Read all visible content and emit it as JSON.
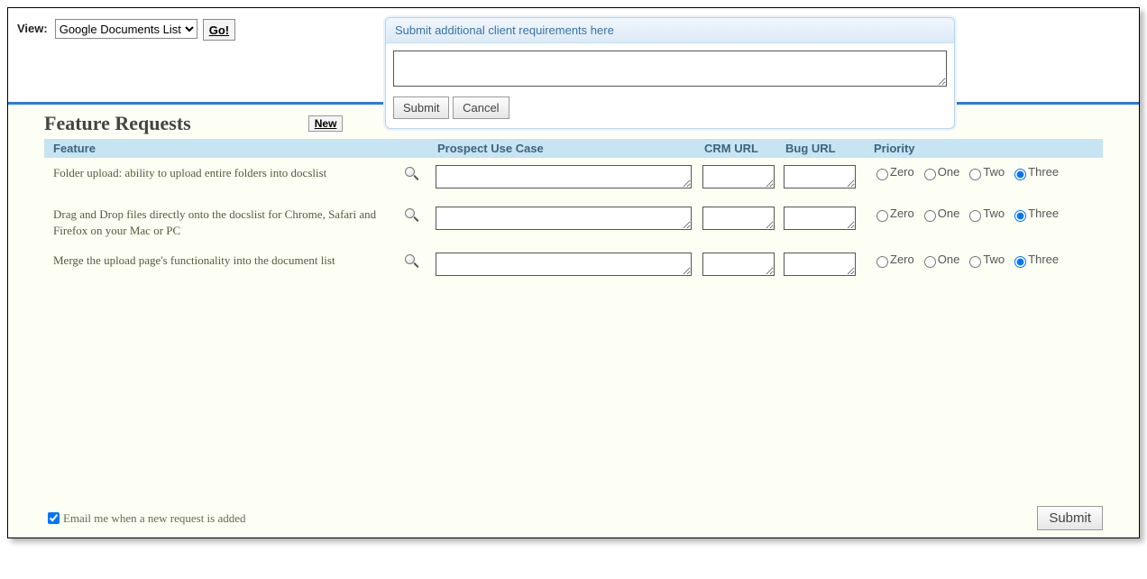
{
  "topbar": {
    "view_label": "View:",
    "select_value": "Google Documents List",
    "go_label": "Go!"
  },
  "req_panel": {
    "title": "Submit additional client requirements here",
    "textarea_value": "",
    "submit_label": "Submit",
    "cancel_label": "Cancel"
  },
  "heading": "Feature Requests",
  "new_label": "New",
  "columns": {
    "feature": "Feature",
    "prospect": "Prospect Use Case",
    "crm": "CRM URL",
    "bug": "Bug URL",
    "priority": "Priority"
  },
  "priority_options": [
    "Zero",
    "One",
    "Two",
    "Three"
  ],
  "rows": [
    {
      "feature": "Folder upload: ability to upload entire folders into docslist",
      "prospect": "",
      "crm": "",
      "bug": "",
      "priority_selected": "Three"
    },
    {
      "feature": "Drag and Drop files directly onto the docslist for Chrome, Safari and Firefox on your Mac or PC",
      "prospect": "",
      "crm": "",
      "bug": "",
      "priority_selected": "Three"
    },
    {
      "feature": "Merge the upload page's functionality into the document list",
      "prospect": "",
      "crm": "",
      "bug": "",
      "priority_selected": "Three"
    }
  ],
  "footer": {
    "email_label": "Email me when a new request is added",
    "email_checked": true,
    "submit_label": "Submit"
  }
}
